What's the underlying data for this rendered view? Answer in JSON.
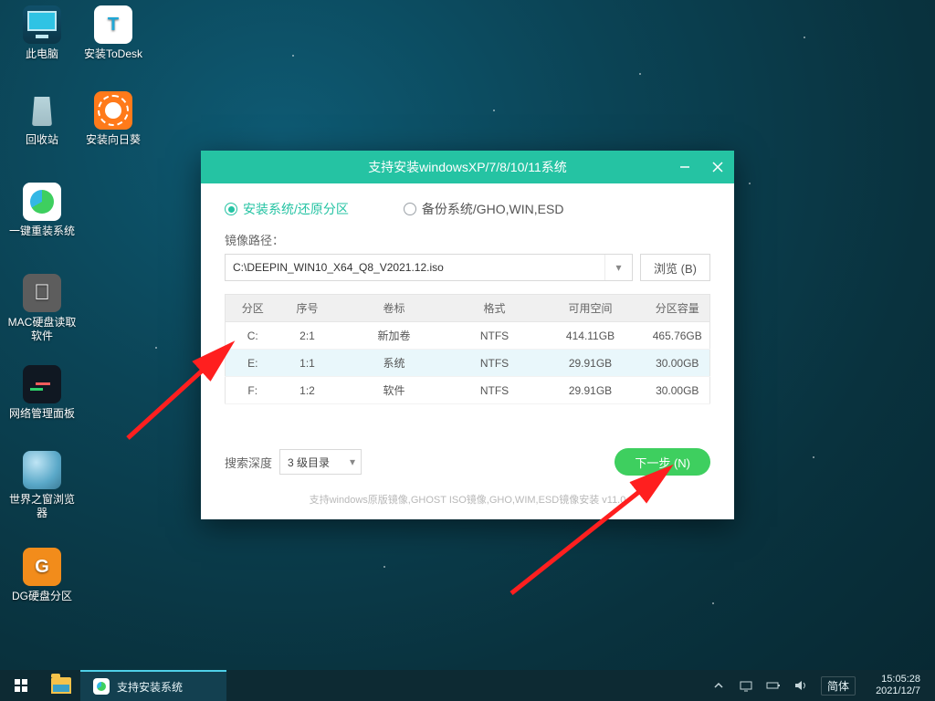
{
  "desktop_icons": {
    "this_pc": "此电脑",
    "todesk": "安装ToDesk",
    "recycle": "回收站",
    "sunlogin": "安装向日葵",
    "reinstall": "一键重装系统",
    "mac": "MAC硬盘读取软件",
    "netpanel": "网络管理面板",
    "theworld": "世界之窗浏览器",
    "diskgenius": "DG硬盘分区"
  },
  "installer": {
    "title": "支持安装windowsXP/7/8/10/11系统",
    "mode_install": "安装系统/还原分区",
    "mode_backup": "备份系统/GHO,WIN,ESD",
    "image_path_label": "镜像路径：",
    "image_path_value": "C:\\DEEPIN_WIN10_X64_Q8_V2021.12.iso",
    "browse_label": "浏览 (B)",
    "columns": {
      "drive": "分区",
      "seq": "序号",
      "vol": "卷标",
      "fs": "格式",
      "free": "可用空间",
      "total": "分区容量"
    },
    "rows": [
      {
        "drive": "C:",
        "seq": "2:1",
        "vol": "新加卷",
        "fs": "NTFS",
        "free": "414.11GB",
        "total": "465.76GB",
        "selected": false
      },
      {
        "drive": "E:",
        "seq": "1:1",
        "vol": "系统",
        "fs": "NTFS",
        "free": "29.91GB",
        "total": "30.00GB",
        "selected": true
      },
      {
        "drive": "F:",
        "seq": "1:2",
        "vol": "软件",
        "fs": "NTFS",
        "free": "29.91GB",
        "total": "30.00GB",
        "selected": false
      }
    ],
    "depth_label": "搜索深度",
    "depth_value": "3 级目录",
    "next_label": "下一步 (N)",
    "support_note": "支持windows原版镜像,GHOST ISO镜像,GHO,WIM,ESD镜像安装  v11.0"
  },
  "taskbar": {
    "app_name": "支持安装系统",
    "ime": "简体",
    "time": "15:05:28",
    "date": "2021/12/7"
  }
}
